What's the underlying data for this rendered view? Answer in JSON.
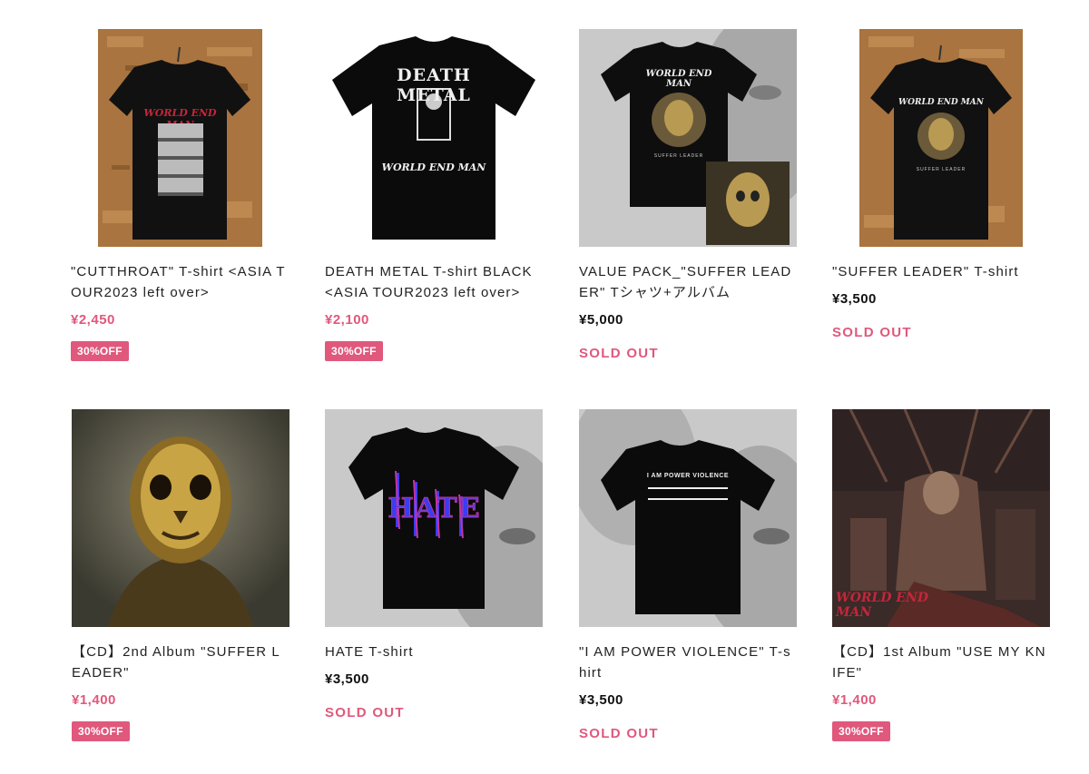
{
  "products": [
    {
      "title": "\"CUTTHROAT\" T-shirt <ASIA TOUR2023 left over>",
      "price": "¥2,450",
      "status": "30%OFF",
      "status_type": "badge",
      "image": "cutthroat-tshirt",
      "print_text": "WORLD END MAN"
    },
    {
      "title": "DEATH METAL T-shirt BLACK <ASIA TOUR2023 left over>",
      "price": "¥2,100",
      "status": "30%OFF",
      "status_type": "badge",
      "image": "death-metal-tshirt",
      "print_text": "DEATH METAL",
      "print_text2": "WORLD END MAN"
    },
    {
      "title": "VALUE PACK_\"SUFFER LEADER\" Tシャツ+アルバム",
      "price": "¥5,000",
      "status": "SOLD OUT",
      "status_type": "soldout",
      "image": "value-pack",
      "print_text": "WORLD END MAN",
      "print_text2": "SUFFER LEADER"
    },
    {
      "title": "\"SUFFER LEADER\" T-shirt",
      "price": "¥3,500",
      "status": "SOLD OUT",
      "status_type": "soldout",
      "image": "suffer-leader-tshirt",
      "print_text": "WORLD END MAN",
      "print_text2": "SUFFER LEADER"
    },
    {
      "title": "【CD】2nd Album \"SUFFER LEADER\"",
      "price": "¥1,400",
      "status": "30%OFF",
      "status_type": "badge",
      "image": "suffer-leader-cd"
    },
    {
      "title": "HATE T-shirt",
      "price": "¥3,500",
      "status": "SOLD OUT",
      "status_type": "soldout",
      "image": "hate-tshirt",
      "print_text": "HATE"
    },
    {
      "title": "\"I AM POWER VIOLENCE\" T-shirt",
      "price": "¥3,500",
      "status": "SOLD OUT",
      "status_type": "soldout",
      "image": "power-violence-tshirt",
      "print_text": "I AM POWER VIOLENCE"
    },
    {
      "title": "【CD】1st Album \"USE MY KNIFE\"",
      "price": "¥1,400",
      "status": "30%OFF",
      "status_type": "badge",
      "image": "use-my-knife-cd",
      "print_text": "WORLD END MAN"
    }
  ],
  "colors": {
    "accent": "#e0587c",
    "price_regular": "#111111"
  }
}
